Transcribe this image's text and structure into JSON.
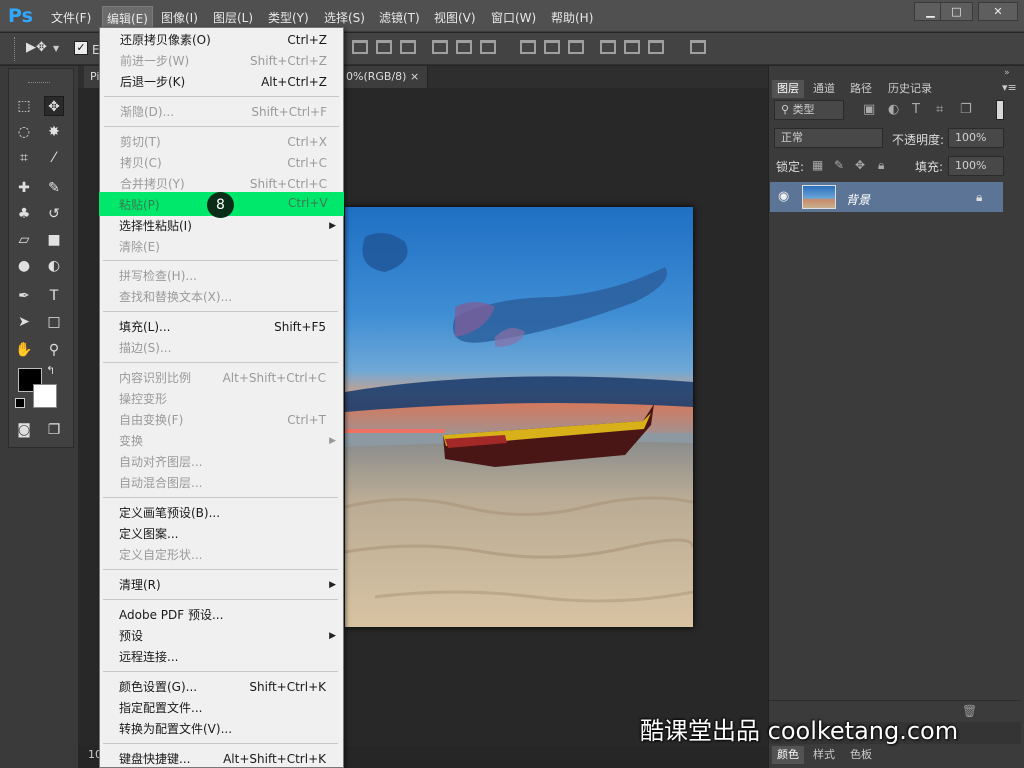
{
  "app": {
    "logo": "Ps",
    "accent": "#31a8ff"
  },
  "menubar": {
    "items": [
      {
        "label": "文件(F)"
      },
      {
        "label": "编辑(E)"
      },
      {
        "label": "图像(I)"
      },
      {
        "label": "图层(L)"
      },
      {
        "label": "类型(Y)"
      },
      {
        "label": "选择(S)"
      },
      {
        "label": "滤镜(T)"
      },
      {
        "label": "视图(V)"
      },
      {
        "label": "窗口(W)"
      },
      {
        "label": "帮助(H)"
      }
    ],
    "window_controls": [
      "minimize-icon",
      "restore-icon",
      "close-icon"
    ]
  },
  "tabs": [
    {
      "label": "Pi"
    },
    {
      "label": "0%(RGB/8)"
    }
  ],
  "tab_close": "×",
  "statusbar": {
    "zoom": "10"
  },
  "edit_menu": {
    "highlight_color": "#00e86c",
    "highlight_badge": "8",
    "items": [
      {
        "label": "还原拷贝像素(O)",
        "shortcut": "Ctrl+Z",
        "enabled": true
      },
      {
        "label": "前进一步(W)",
        "shortcut": "Shift+Ctrl+Z",
        "enabled": false
      },
      {
        "label": "后退一步(K)",
        "shortcut": "Alt+Ctrl+Z",
        "enabled": true
      },
      {
        "label": "渐隐(D)...",
        "shortcut": "Shift+Ctrl+F",
        "enabled": false
      },
      {
        "label": "剪切(T)",
        "shortcut": "Ctrl+X",
        "enabled": false
      },
      {
        "label": "拷贝(C)",
        "shortcut": "Ctrl+C",
        "enabled": false
      },
      {
        "label": "合并拷贝(Y)",
        "shortcut": "Shift+Ctrl+C",
        "enabled": false
      },
      {
        "label": "粘贴(P)",
        "shortcut": "Ctrl+V",
        "enabled": false
      },
      {
        "label": "选择性粘贴(I)",
        "shortcut": "",
        "enabled": true
      },
      {
        "label": "清除(E)",
        "shortcut": "",
        "enabled": false
      },
      {
        "label": "拼写检查(H)...",
        "shortcut": "",
        "enabled": false
      },
      {
        "label": "查找和替换文本(X)...",
        "shortcut": "",
        "enabled": false
      },
      {
        "label": "填充(L)...",
        "shortcut": "Shift+F5",
        "enabled": true
      },
      {
        "label": "描边(S)...",
        "shortcut": "",
        "enabled": false
      },
      {
        "label": "内容识别比例",
        "shortcut": "Alt+Shift+Ctrl+C",
        "enabled": false
      },
      {
        "label": "操控变形",
        "shortcut": "",
        "enabled": false
      },
      {
        "label": "自由变换(F)",
        "shortcut": "Ctrl+T",
        "enabled": false
      },
      {
        "label": "变换",
        "shortcut": "",
        "enabled": false
      },
      {
        "label": "自动对齐图层...",
        "shortcut": "",
        "enabled": false
      },
      {
        "label": "自动混合图层...",
        "shortcut": "",
        "enabled": false
      },
      {
        "label": "定义画笔预设(B)...",
        "shortcut": "",
        "enabled": true
      },
      {
        "label": "定义图案...",
        "shortcut": "",
        "enabled": true
      },
      {
        "label": "定义自定形状...",
        "shortcut": "",
        "enabled": false
      },
      {
        "label": "清理(R)",
        "shortcut": "",
        "enabled": true
      },
      {
        "label": "Adobe PDF 预设...",
        "shortcut": "",
        "enabled": true
      },
      {
        "label": "预设",
        "shortcut": "",
        "enabled": true
      },
      {
        "label": "远程连接...",
        "shortcut": "",
        "enabled": true
      },
      {
        "label": "颜色设置(G)...",
        "shortcut": "Shift+Ctrl+K",
        "enabled": true
      },
      {
        "label": "指定配置文件...",
        "shortcut": "",
        "enabled": true
      },
      {
        "label": "转换为配置文件(V)...",
        "shortcut": "",
        "enabled": true
      },
      {
        "label": "键盘快捷键...",
        "shortcut": "Alt+Shift+Ctrl+K",
        "enabled": true
      }
    ]
  },
  "layers_panel": {
    "tabs": [
      {
        "label": "图层"
      },
      {
        "label": "通道"
      },
      {
        "label": "路径"
      },
      {
        "label": "历史记录"
      }
    ],
    "filter_label": "类型",
    "blend_mode": "正常",
    "opacity_label": "不透明度:",
    "opacity_value": "100%",
    "lock_label": "锁定:",
    "fill_label": "填充:",
    "fill_value": "100%",
    "layer_name": "背景"
  },
  "bottom_panel": {
    "tabs": [
      {
        "label": "颜色"
      },
      {
        "label": "样式"
      },
      {
        "label": "色板"
      }
    ]
  },
  "watermark": "酷课堂出品 coolketang.com"
}
